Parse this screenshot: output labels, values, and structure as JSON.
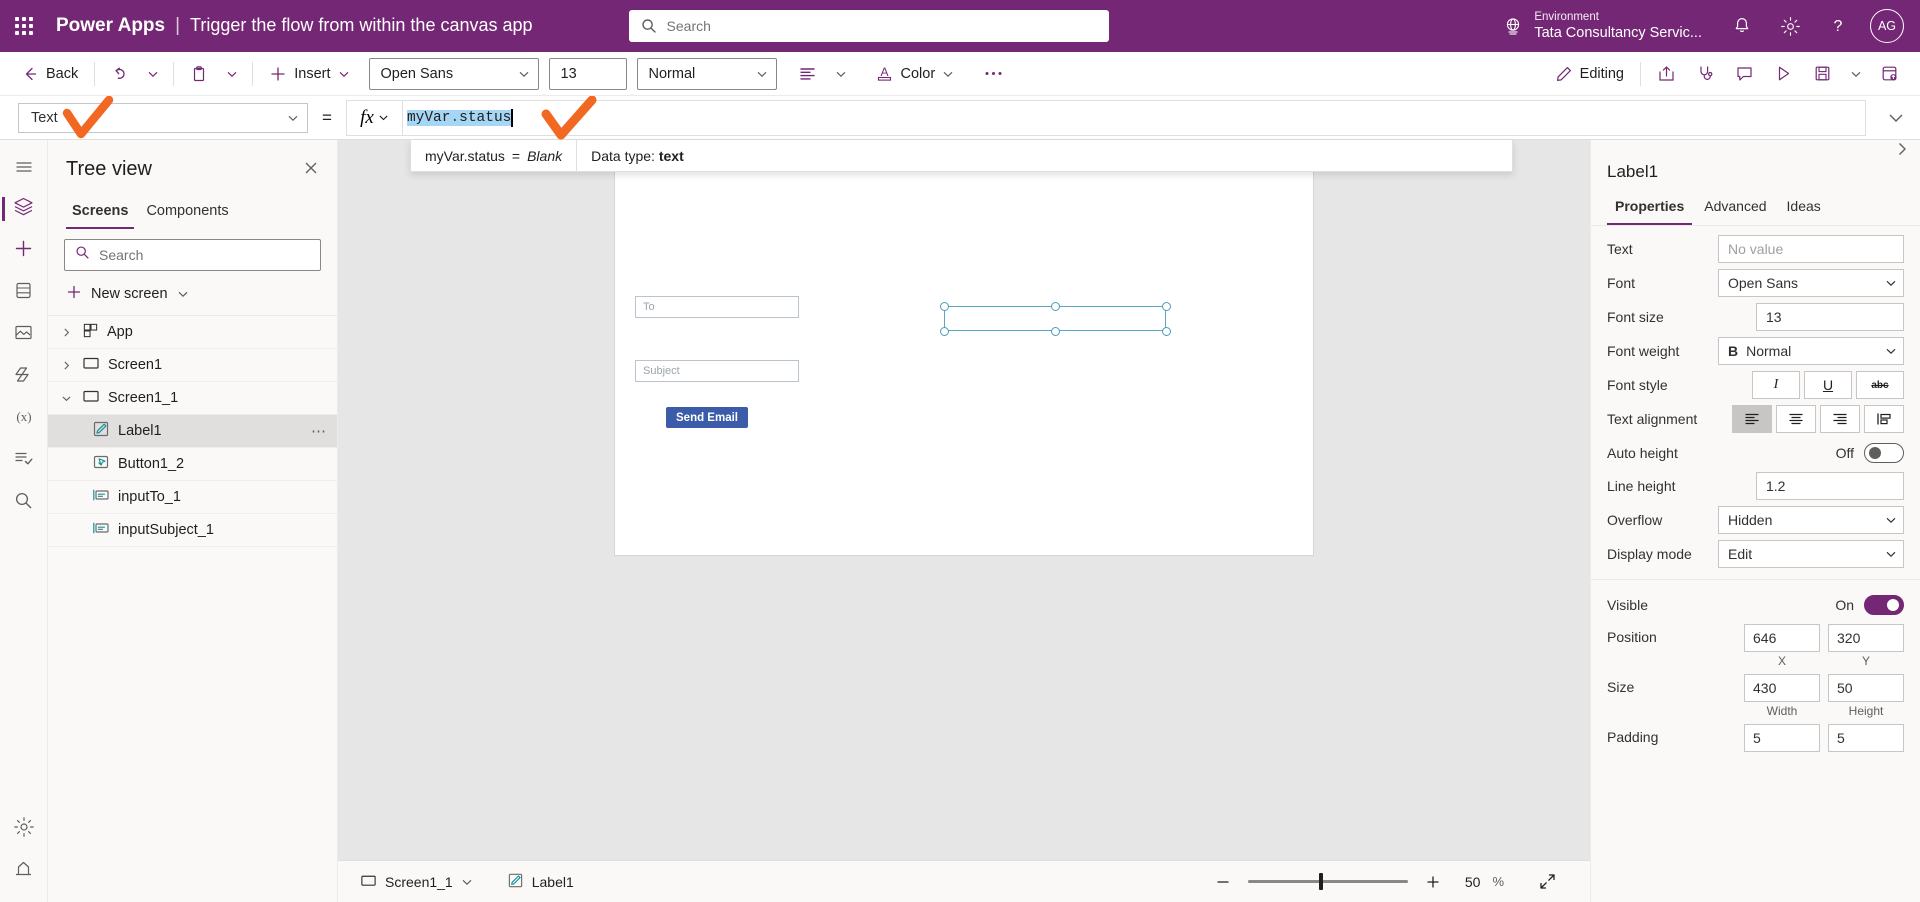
{
  "header": {
    "waffle_icon": "waffle-grid-icon",
    "brand": "Power Apps",
    "separator": "|",
    "app_title": "Trigger the flow from within the canvas app",
    "search": {
      "placeholder": "Search",
      "value": "",
      "icon": "search-icon"
    },
    "environment_label": "Environment",
    "environment_name": "Tata Consultancy Servic...",
    "environment_icon": "globe-icon",
    "notifications_icon": "bell-icon",
    "settings_icon": "gear-icon",
    "help_icon": "question-mark-icon",
    "avatar_initials": "AG",
    "bar_color": "#742774"
  },
  "commandbar": {
    "back_label": "Back",
    "back_icon": "arrow-left-icon",
    "undo_icon": "undo-icon",
    "undo_caret_icon": "chevron-down-icon",
    "paste_icon": "clipboard-icon",
    "paste_caret_icon": "chevron-down-icon",
    "insert_label": "Insert",
    "insert_icon": "plus-icon",
    "insert_caret_icon": "chevron-down-icon",
    "font_name": "Open Sans",
    "font_size": "13",
    "font_weight": "Normal",
    "align_icon": "align-left-icon",
    "align_caret_icon": "chevron-down-icon",
    "color_label": "Color",
    "color_icon": "font-color-icon",
    "color_caret_icon": "chevron-down-icon",
    "more_icon": "ellipsis-icon",
    "editing_label": "Editing",
    "editing_icon": "pencil-icon",
    "share_icon": "share-icon",
    "checker_icon": "app-checker-stethoscope-icon",
    "comments_icon": "comment-icon",
    "preview_icon": "play-triangle-icon",
    "save_icon": "save-disk-icon",
    "save_caret_icon": "chevron-down-icon",
    "publish_icon": "publish-icon"
  },
  "formulabar": {
    "property_value": "Text",
    "property_caret_icon": "chevron-down-icon",
    "equals": "=",
    "fx_icon": "fx-icon",
    "fx_caret_icon": "chevron-down-icon",
    "formula_token": "myVar",
    "formula_dot": ".",
    "formula_rest": "status",
    "expand_icon": "chevron-down-icon",
    "intellisense": {
      "expression": "myVar.status",
      "equals": "=",
      "result": "Blank",
      "datatype_label": "Data type:",
      "datatype_value": "text"
    }
  },
  "rail": {
    "items": [
      {
        "name": "hamburger-menu-icon",
        "label": "Menu"
      },
      {
        "name": "tree-view-layers-icon",
        "label": "Tree view"
      },
      {
        "name": "insert-plus-icon",
        "label": "Insert"
      },
      {
        "name": "data-cylinder-icon",
        "label": "Data"
      },
      {
        "name": "media-image-icon",
        "label": "Media"
      },
      {
        "name": "power-automate-icon",
        "label": "Power Automate"
      },
      {
        "name": "variables-fx-icon",
        "label": "Variables"
      },
      {
        "name": "app-checker-icon",
        "label": "App checker"
      },
      {
        "name": "advanced-search-icon",
        "label": "Search"
      }
    ],
    "bottom_items": [
      {
        "name": "settings-gear-icon",
        "label": "Settings"
      },
      {
        "name": "extensions-icon",
        "label": "Extensions"
      }
    ]
  },
  "treeview": {
    "title": "Tree view",
    "close_icon": "close-icon",
    "tabs": [
      {
        "label": "Screens",
        "active": true
      },
      {
        "label": "Components",
        "active": false
      }
    ],
    "search": {
      "placeholder": "Search",
      "value": "",
      "icon": "search-icon"
    },
    "new_screen_label": "New screen",
    "new_screen_icon": "plus-icon",
    "new_screen_caret_icon": "chevron-down-icon",
    "nodes": [
      {
        "label": "App",
        "icon": "app-icon",
        "chevron": "chevron-right-icon",
        "level": 0,
        "selected": false,
        "menu": false
      },
      {
        "label": "Screen1",
        "icon": "screen-rectangle-icon",
        "chevron": "chevron-right-icon",
        "level": 0,
        "selected": false,
        "menu": false
      },
      {
        "label": "Screen1_1",
        "icon": "screen-rectangle-icon",
        "chevron": "chevron-down-icon",
        "level": 0,
        "selected": false,
        "menu": false
      },
      {
        "label": "Label1",
        "icon": "label-pencil-icon",
        "chevron": "",
        "level": 1,
        "selected": true,
        "menu": true,
        "menu_icon": "ellipsis-icon"
      },
      {
        "label": "Button1_2",
        "icon": "button-icon",
        "chevron": "",
        "level": 1,
        "selected": false,
        "menu": false
      },
      {
        "label": "inputTo_1",
        "icon": "text-input-icon",
        "chevron": "",
        "level": 1,
        "selected": false,
        "menu": false
      },
      {
        "label": "inputSubject_1",
        "icon": "text-input-icon",
        "chevron": "",
        "level": 1,
        "selected": false,
        "menu": false
      }
    ]
  },
  "canvas": {
    "widgets": [
      {
        "type": "input",
        "name": "to-input",
        "placeholder": "To"
      },
      {
        "type": "input",
        "name": "subject-input",
        "placeholder": "Subject"
      },
      {
        "type": "button",
        "name": "send-email-button",
        "label": "Send Email"
      },
      {
        "type": "selection",
        "name": "label1-selection"
      }
    ]
  },
  "statusbar": {
    "screen_icon": "screen-rectangle-icon",
    "screen_label": "Screen1_1",
    "screen_caret_icon": "chevron-down-icon",
    "control_icon": "label-pencil-icon",
    "control_label": "Label1",
    "zoom_out_icon": "minus-icon",
    "zoom_in_icon": "plus-icon",
    "zoom_value": "50",
    "zoom_unit": "%",
    "fit_icon": "fit-screen-expand-icon"
  },
  "properties": {
    "collapse_icon": "chevron-right-icon",
    "control_name": "Label1",
    "tabs": [
      {
        "label": "Properties",
        "active": true
      },
      {
        "label": "Advanced",
        "active": false
      },
      {
        "label": "Ideas",
        "active": false
      }
    ],
    "rows": [
      {
        "name": "text",
        "label": "Text",
        "kind": "text",
        "value": "No value",
        "placeholder": true
      },
      {
        "name": "font",
        "label": "Font",
        "kind": "dropdown",
        "value": "Open Sans"
      },
      {
        "name": "font-size",
        "label": "Font size",
        "kind": "number",
        "value": "13"
      },
      {
        "name": "font-weight",
        "label": "Font weight",
        "kind": "dropdown-bold",
        "value": "Normal",
        "prefix": "B"
      },
      {
        "name": "font-style",
        "label": "Font style",
        "kind": "buttons3",
        "buttons": [
          "I",
          "U",
          "abc"
        ]
      },
      {
        "name": "text-alignment",
        "label": "Text alignment",
        "kind": "align4",
        "selected": 0
      },
      {
        "name": "auto-height",
        "label": "Auto height",
        "kind": "toggle",
        "state_label": "Off",
        "on": false
      },
      {
        "name": "line-height",
        "label": "Line height",
        "kind": "number",
        "value": "1.2"
      },
      {
        "name": "overflow",
        "label": "Overflow",
        "kind": "dropdown",
        "value": "Hidden"
      },
      {
        "name": "display-mode",
        "label": "Display mode",
        "kind": "dropdown",
        "value": "Edit"
      }
    ],
    "rows2": [
      {
        "name": "visible",
        "label": "Visible",
        "kind": "toggle",
        "state_label": "On",
        "on": true
      },
      {
        "name": "position",
        "label": "Position",
        "kind": "pair",
        "v1": "646",
        "v2": "320",
        "c1": "X",
        "c2": "Y"
      },
      {
        "name": "size",
        "label": "Size",
        "kind": "pair",
        "v1": "430",
        "v2": "50",
        "c1": "Width",
        "c2": "Height"
      },
      {
        "name": "padding",
        "label": "Padding",
        "kind": "pair",
        "v1": "5",
        "v2": "5",
        "c1": "",
        "c2": ""
      }
    ]
  },
  "annotations": [
    {
      "name": "orange-check-annotation-property",
      "color": "#f26722"
    },
    {
      "name": "orange-check-annotation-formula",
      "color": "#f26722"
    }
  ]
}
